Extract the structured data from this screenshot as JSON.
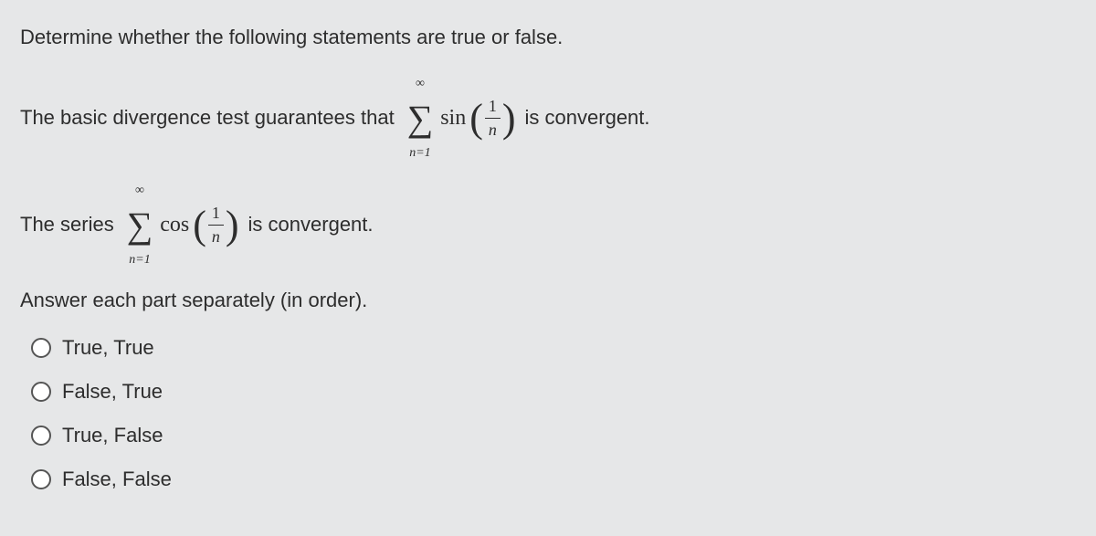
{
  "question": {
    "header": "Determine whether the following statements are true or false.",
    "instruction": "Answer each part separately (in order)."
  },
  "statement1": {
    "pre": "The basic divergence test guarantees that",
    "sum_top": "∞",
    "sum_bottom": "n=1",
    "fn": "sin",
    "frac_num": "1",
    "frac_den": "n",
    "post": "is convergent."
  },
  "statement2": {
    "pre": "The series",
    "sum_top": "∞",
    "sum_bottom": "n=1",
    "fn": "cos",
    "frac_num": "1",
    "frac_den": "n",
    "post": "is convergent."
  },
  "options": [
    "True, True",
    "False, True",
    "True, False",
    "False, False"
  ]
}
